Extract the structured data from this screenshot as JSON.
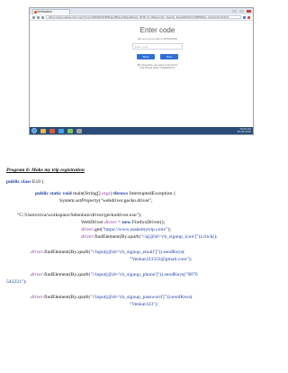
{
  "screenshot": {
    "tab_title": "Verification",
    "url": "https://www.makemytrip.com/?cmp=SEM|D|DF|B|Brand|Brand-BrandExact_DT|B_M_Makemytrip_Search_Exact|RSA|673458560&s_kwcid=AL!1631!3",
    "modal": {
      "title": "Enter code",
      "subtitle": "We sent you a code to 9876543210",
      "input_placeholder": "Enter code",
      "button_left": "Back",
      "button_right": "Next",
      "note": "By proceeding, you agree to the Terms and Privacy policy of MakeMyTrip"
    },
    "tray_time": "10:23 AM",
    "tray_date": "25-09-2019"
  },
  "document": {
    "heading": "Program 8: Make my trip registration",
    "class_kw": "public class",
    "class_name": " Ex9 {",
    "main_kw": "public static void",
    "main_rest": " main(String[] ",
    "main_args": "args",
    "main_close": ") ",
    "throws_kw": "throws",
    "throws_rest": " InterruptedException {",
    "setprop_obj": "System.",
    "setprop_method": "setProperty",
    "setprop_arg": "(\"webdriver.gecko.driver\",",
    "gecko_path": "\"C:/Users/siva/workspace/Selenium/driver/geckodriver.exe\");",
    "wd_type": "WebDriver ",
    "wd_var": "driver",
    "wd_eq": " = ",
    "wd_new": "new",
    "wd_rest": " FirefoxDriver();",
    "get_var": "driver",
    "get_rest": ".get(",
    "get_url": "\"https://www.makemytrip.com/\"",
    "get_end": ");",
    "signup_var": "driver",
    "signup_rest": ".findElement(By.",
    "signup_xpath": "xpath",
    "signup_arg": "(\"//a[@id='ch_signup_icon']\")).click();",
    "email_var": "driver",
    "email_rest": ".findElement(By.",
    "email_xpath": "xpath",
    "email_arg": "(\"//input[@id='ch_signup_email']\")).sendKeys(",
    "email_val": "\"Venkat123333@gmail.com\");",
    "phone_var": "driver",
    "phone_rest": ".findElement(By.",
    "phone_xpath": "xpath",
    "phone_arg": "(\"//input[@id='ch_signup_phone']\")).sendKeys(\"9876",
    "phone_cont": "543221\");",
    "pw_var": "driver",
    "pw_rest": ".findElement(By.",
    "pw_xpath": "xpath",
    "pw_arg": "(\"//input[@id='ch_signup_password']\")).sendKeys(",
    "pw_val": "\"Venkat123\");"
  }
}
